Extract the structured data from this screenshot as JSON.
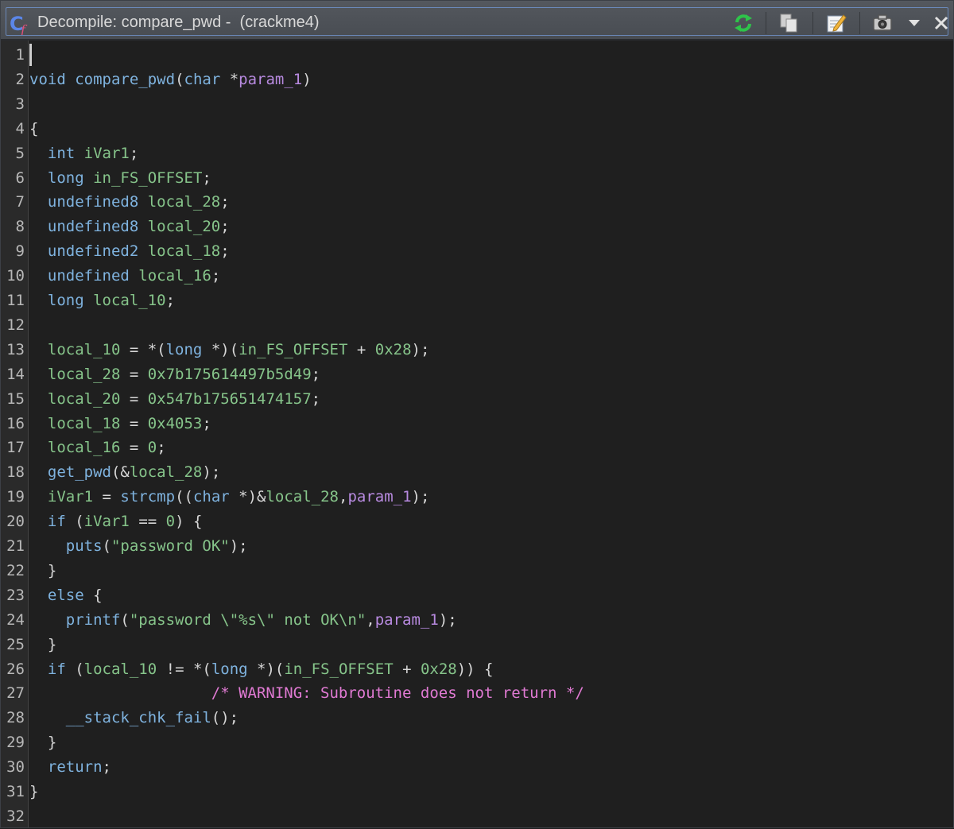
{
  "window": {
    "title": "Decompile: compare_pwd -  (crackme4)"
  },
  "toolbar": {
    "icons": [
      "refresh-icon",
      "copy-icon",
      "edit-icon",
      "snapshot-icon",
      "menu-dropdown-icon",
      "close-icon"
    ],
    "accent_color": "#6a88b8"
  },
  "editor": {
    "line_numbers": [
      "1",
      "2",
      "3",
      "4",
      "5",
      "6",
      "7",
      "8",
      "9",
      "10",
      "11",
      "12",
      "13",
      "14",
      "15",
      "16",
      "17",
      "18",
      "19",
      "20",
      "21",
      "22",
      "23",
      "24",
      "25",
      "26",
      "27",
      "28",
      "29",
      "30",
      "31",
      "32"
    ],
    "lines": [
      [],
      [
        [
          "kw",
          "void"
        ],
        [
          "punc",
          " "
        ],
        [
          "fn",
          "compare_pwd"
        ],
        [
          "punc",
          "("
        ],
        [
          "ty",
          "char"
        ],
        [
          "punc",
          " *"
        ],
        [
          "prm",
          "param_1"
        ],
        [
          "punc",
          ")"
        ]
      ],
      [],
      [
        [
          "punc",
          "{"
        ]
      ],
      [
        [
          "punc",
          "  "
        ],
        [
          "ty",
          "int"
        ],
        [
          "punc",
          " "
        ],
        [
          "var",
          "iVar1"
        ],
        [
          "punc",
          ";"
        ]
      ],
      [
        [
          "punc",
          "  "
        ],
        [
          "ty",
          "long"
        ],
        [
          "punc",
          " "
        ],
        [
          "var",
          "in_FS_OFFSET"
        ],
        [
          "punc",
          ";"
        ]
      ],
      [
        [
          "punc",
          "  "
        ],
        [
          "ty",
          "undefined8"
        ],
        [
          "punc",
          " "
        ],
        [
          "var",
          "local_28"
        ],
        [
          "punc",
          ";"
        ]
      ],
      [
        [
          "punc",
          "  "
        ],
        [
          "ty",
          "undefined8"
        ],
        [
          "punc",
          " "
        ],
        [
          "var",
          "local_20"
        ],
        [
          "punc",
          ";"
        ]
      ],
      [
        [
          "punc",
          "  "
        ],
        [
          "ty",
          "undefined2"
        ],
        [
          "punc",
          " "
        ],
        [
          "var",
          "local_18"
        ],
        [
          "punc",
          ";"
        ]
      ],
      [
        [
          "punc",
          "  "
        ],
        [
          "ty",
          "undefined"
        ],
        [
          "punc",
          " "
        ],
        [
          "var",
          "local_16"
        ],
        [
          "punc",
          ";"
        ]
      ],
      [
        [
          "punc",
          "  "
        ],
        [
          "ty",
          "long"
        ],
        [
          "punc",
          " "
        ],
        [
          "var",
          "local_10"
        ],
        [
          "punc",
          ";"
        ]
      ],
      [],
      [
        [
          "punc",
          "  "
        ],
        [
          "var",
          "local_10"
        ],
        [
          "punc",
          " = *("
        ],
        [
          "ty",
          "long"
        ],
        [
          "punc",
          " *)("
        ],
        [
          "var",
          "in_FS_OFFSET"
        ],
        [
          "punc",
          " + "
        ],
        [
          "num",
          "0x28"
        ],
        [
          "punc",
          ");"
        ]
      ],
      [
        [
          "punc",
          "  "
        ],
        [
          "var",
          "local_28"
        ],
        [
          "punc",
          " = "
        ],
        [
          "num",
          "0x7b175614497b5d49"
        ],
        [
          "punc",
          ";"
        ]
      ],
      [
        [
          "punc",
          "  "
        ],
        [
          "var",
          "local_20"
        ],
        [
          "punc",
          " = "
        ],
        [
          "num",
          "0x547b175651474157"
        ],
        [
          "punc",
          ";"
        ]
      ],
      [
        [
          "punc",
          "  "
        ],
        [
          "var",
          "local_18"
        ],
        [
          "punc",
          " = "
        ],
        [
          "num",
          "0x4053"
        ],
        [
          "punc",
          ";"
        ]
      ],
      [
        [
          "punc",
          "  "
        ],
        [
          "var",
          "local_16"
        ],
        [
          "punc",
          " = "
        ],
        [
          "num",
          "0"
        ],
        [
          "punc",
          ";"
        ]
      ],
      [
        [
          "punc",
          "  "
        ],
        [
          "fn",
          "get_pwd"
        ],
        [
          "punc",
          "(&"
        ],
        [
          "var",
          "local_28"
        ],
        [
          "punc",
          ");"
        ]
      ],
      [
        [
          "punc",
          "  "
        ],
        [
          "var",
          "iVar1"
        ],
        [
          "punc",
          " = "
        ],
        [
          "fn",
          "strcmp"
        ],
        [
          "punc",
          "(("
        ],
        [
          "ty",
          "char"
        ],
        [
          "punc",
          " *)&"
        ],
        [
          "var",
          "local_28"
        ],
        [
          "punc",
          ","
        ],
        [
          "prm",
          "param_1"
        ],
        [
          "punc",
          ");"
        ]
      ],
      [
        [
          "punc",
          "  "
        ],
        [
          "kw",
          "if"
        ],
        [
          "punc",
          " ("
        ],
        [
          "var",
          "iVar1"
        ],
        [
          "punc",
          " == "
        ],
        [
          "num",
          "0"
        ],
        [
          "punc",
          ") {"
        ]
      ],
      [
        [
          "punc",
          "    "
        ],
        [
          "fn",
          "puts"
        ],
        [
          "punc",
          "("
        ],
        [
          "str",
          "\"password OK\""
        ],
        [
          "punc",
          ");"
        ]
      ],
      [
        [
          "punc",
          "  }"
        ]
      ],
      [
        [
          "punc",
          "  "
        ],
        [
          "kw",
          "else"
        ],
        [
          "punc",
          " {"
        ]
      ],
      [
        [
          "punc",
          "    "
        ],
        [
          "fn",
          "printf"
        ],
        [
          "punc",
          "("
        ],
        [
          "str",
          "\"password \\\"%s\\\" not OK\\n\""
        ],
        [
          "punc",
          ","
        ],
        [
          "prm",
          "param_1"
        ],
        [
          "punc",
          ");"
        ]
      ],
      [
        [
          "punc",
          "  }"
        ]
      ],
      [
        [
          "punc",
          "  "
        ],
        [
          "kw",
          "if"
        ],
        [
          "punc",
          " ("
        ],
        [
          "var",
          "local_10"
        ],
        [
          "punc",
          " != *("
        ],
        [
          "ty",
          "long"
        ],
        [
          "punc",
          " *)("
        ],
        [
          "var",
          "in_FS_OFFSET"
        ],
        [
          "punc",
          " + "
        ],
        [
          "num",
          "0x28"
        ],
        [
          "punc",
          ")) {"
        ]
      ],
      [
        [
          "punc",
          "                    "
        ],
        [
          "cmt",
          "/* WARNING: Subroutine does not return */"
        ]
      ],
      [
        [
          "punc",
          "    "
        ],
        [
          "fn",
          "__stack_chk_fail"
        ],
        [
          "punc",
          "();"
        ]
      ],
      [
        [
          "punc",
          "  }"
        ]
      ],
      [
        [
          "punc",
          "  "
        ],
        [
          "kw",
          "return"
        ],
        [
          "punc",
          ";"
        ]
      ],
      [
        [
          "punc",
          "}"
        ]
      ],
      []
    ]
  }
}
